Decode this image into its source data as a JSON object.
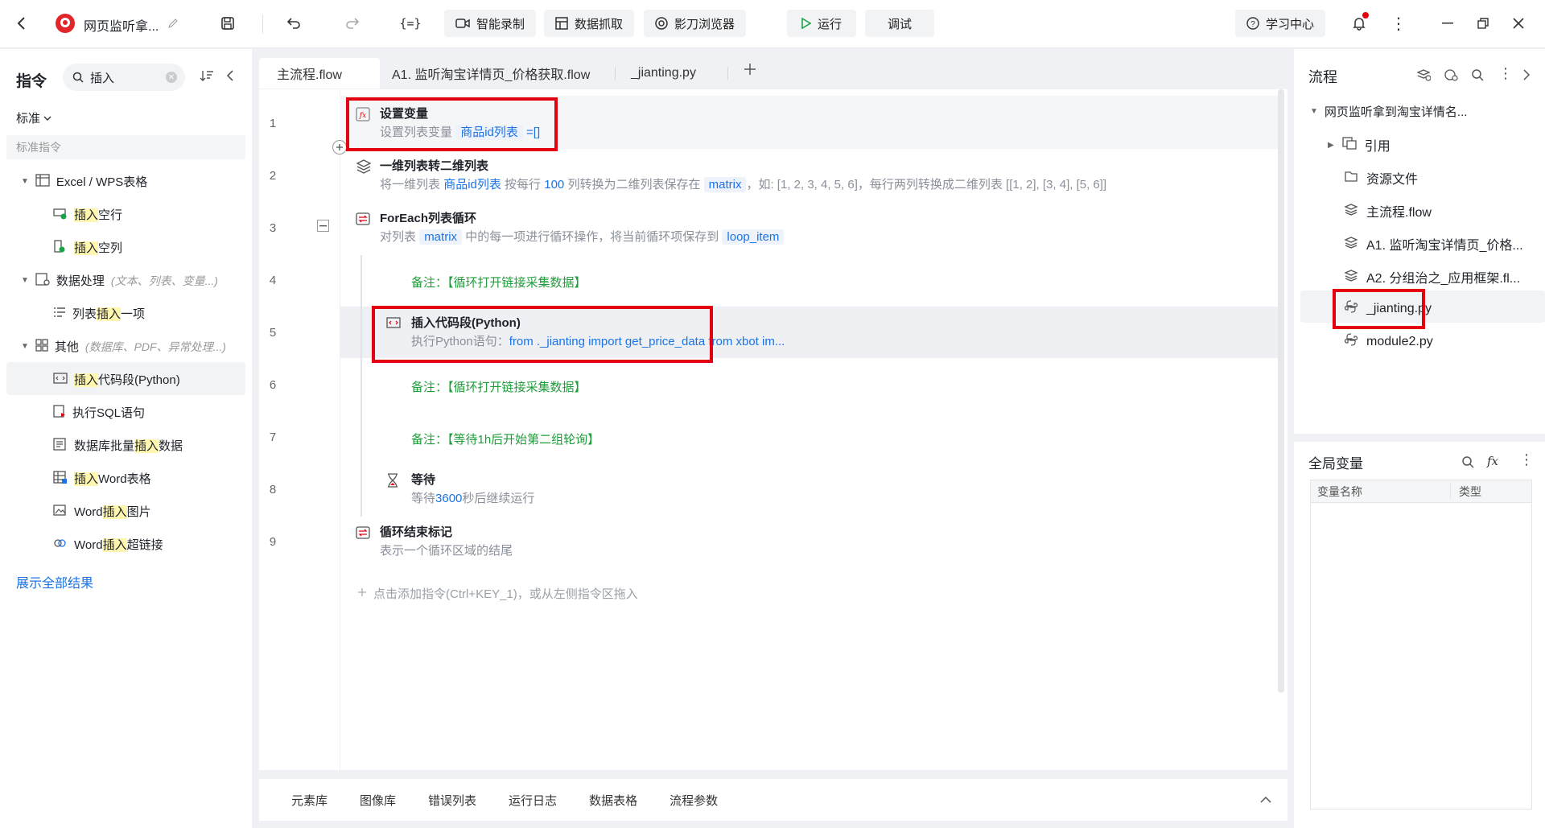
{
  "header": {
    "title": "网页监听拿...",
    "buttons": {
      "smart_record": "智能录制",
      "data_capture": "数据抓取",
      "browser": "影刀浏览器",
      "run": "运行",
      "debug": "调试",
      "learning": "学习中心"
    }
  },
  "left": {
    "title": "指令",
    "search_value": "插入",
    "filter": "标准",
    "section": "标准指令",
    "groups": [
      {
        "label": "Excel / WPS表格",
        "sub": "",
        "items": [
          {
            "hl": "插入",
            "rest": "空行",
            "pre": ""
          },
          {
            "hl": "插入",
            "rest": "空列",
            "pre": ""
          }
        ]
      },
      {
        "label": "数据处理",
        "sub": "(文本、列表、变量...)",
        "items": [
          {
            "pre": "列表",
            "hl": "插入",
            "rest": "一项"
          }
        ]
      },
      {
        "label": "其他",
        "sub": "(数据库、PDF、异常处理...)",
        "items": [
          {
            "pre": "",
            "hl": "插入",
            "rest": "代码段(Python)"
          },
          {
            "pre": "执行SQL语句",
            "hl": "",
            "rest": ""
          },
          {
            "pre": "数据库批量",
            "hl": "插入",
            "rest": "数据"
          },
          {
            "pre": "",
            "hl": "插入",
            "rest": "Word表格"
          },
          {
            "pre": "Word",
            "hl": "插入",
            "rest": "图片"
          },
          {
            "pre": "Word",
            "hl": "插入",
            "rest": "超链接"
          }
        ]
      }
    ],
    "show_all": "展示全部结果"
  },
  "tabs": [
    "主流程.flow",
    "A1. 监听淘宝详情页_价格获取.flow",
    "_jianting.py"
  ],
  "steps": {
    "s1": {
      "num": "1",
      "title": "设置变量",
      "desc_pre": "设置列表变量",
      "var": "商品id列表",
      "desc_post": "=[]"
    },
    "s2": {
      "num": "2",
      "title": "一维列表转二维列表",
      "p1": "将一维列表",
      "var": "商品id列表",
      "p2": "按每行",
      "n": "100",
      "p3": "列转换为二维列表保存在",
      "var2": "matrix",
      "p4": "，如: [1, 2, 3, 4, 5, 6]，每行两列转换成二维列表 [[1, 2], [3, 4], [5, 6]]"
    },
    "s3": {
      "num": "3",
      "title": "ForEach列表循环",
      "p1": "对列表",
      "var": "matrix",
      "p2": "中的每一项进行循环操作，将当前循环项保存到",
      "var2": "loop_item"
    },
    "s4": {
      "num": "4",
      "note": "备注：【循环打开链接采集数据】"
    },
    "s5": {
      "num": "5",
      "title": "插入代码段(Python)",
      "p1": "执行Python语句：",
      "code": "from ._jianting import get_price_data from xbot im..."
    },
    "s6": {
      "num": "6",
      "note": "备注：【循环打开链接采集数据】"
    },
    "s7": {
      "num": "7",
      "note": "备注：【等待1h后开始第二组轮询】"
    },
    "s8": {
      "num": "8",
      "title": "等待",
      "p1": "等待",
      "n": "3600",
      "p2": "秒后继续运行"
    },
    "s9": {
      "num": "9",
      "title": "循环结束标记",
      "desc": "表示一个循环区域的结尾"
    }
  },
  "add_hint": "点击添加指令(Ctrl+KEY_1)，或从左侧指令区拖入",
  "bottom_tabs": [
    "元素库",
    "图像库",
    "错误列表",
    "运行日志",
    "数据表格",
    "流程参数"
  ],
  "right": {
    "title": "流程",
    "root": "网页监听拿到淘宝详情名...",
    "items": [
      "引用",
      "资源文件",
      "主流程.flow",
      "A1. 监听淘宝详情页_价格...",
      "A2. 分组治之_应用框架.fl...",
      "_jianting.py",
      "module2.py"
    ],
    "globals_title": "全局变量",
    "col_name": "变量名称",
    "col_type": "类型"
  }
}
